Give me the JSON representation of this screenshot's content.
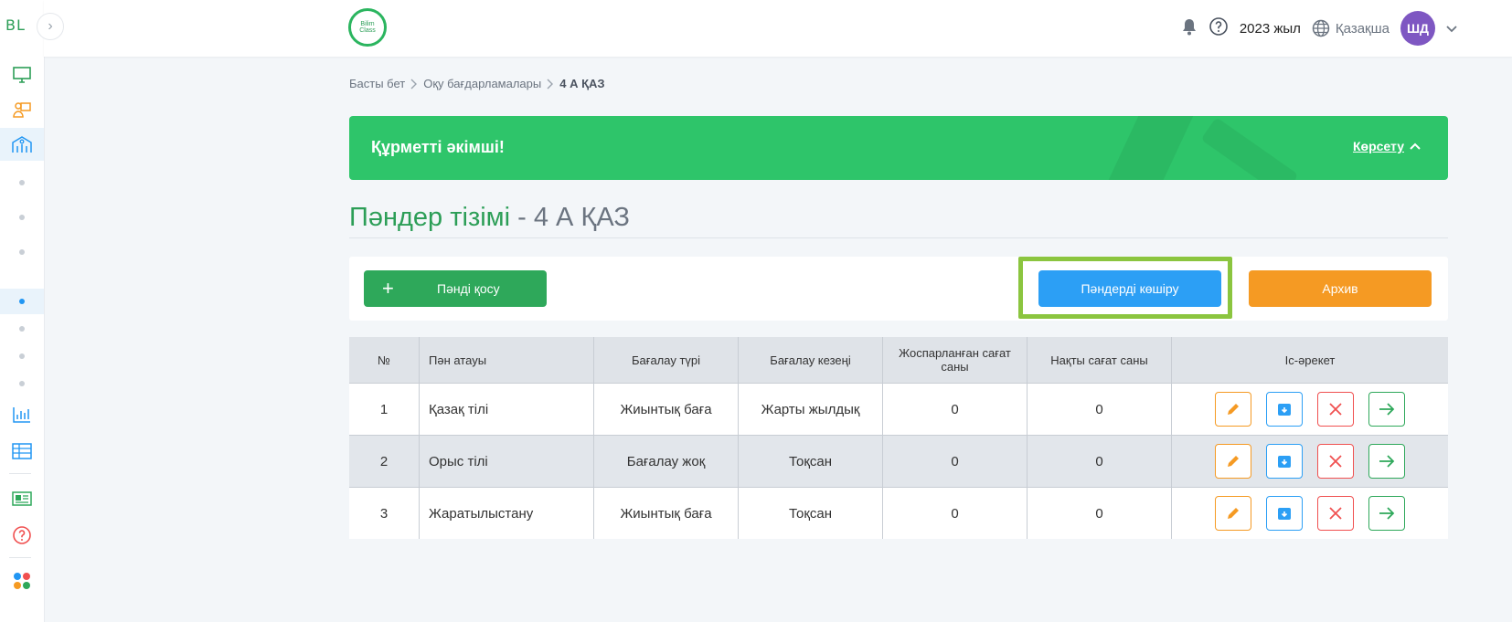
{
  "sidebar": {
    "logo": "BL",
    "toggle_glyph": "›"
  },
  "header": {
    "brand_line1": "Bilim",
    "brand_line2": "Class",
    "year": "2023 жыл",
    "language": "Қазақша",
    "avatar_initials": "ШД"
  },
  "breadcrumb": {
    "items": [
      "Басты бет",
      "Оқу бағдарламалары"
    ],
    "current": "4 А ҚАЗ"
  },
  "banner": {
    "title": "Құрметті әкімші!",
    "link": "Көрсету",
    "color": "#2ec56a"
  },
  "page": {
    "title": "Пәндер тізімі",
    "separator": " - ",
    "class_name": "4 А ҚАЗ"
  },
  "actions": {
    "add_label": "Пәнді қосу",
    "add_glyph": "+",
    "copy_label": "Пәндерді көшіру",
    "archive_label": "Архив"
  },
  "table": {
    "headers": [
      "№",
      "Пән атауы",
      "Бағалау түрі",
      "Бағалау кезеңі",
      "Жоспарланған сағат саны",
      "Нақты сағат саны",
      "Іс-әрекет"
    ],
    "rows": [
      {
        "num": "1",
        "name": "Қазақ тілі",
        "type": "Жиынтық баға",
        "period": "Жарты жылдық",
        "planned": "0",
        "actual": "0"
      },
      {
        "num": "2",
        "name": "Орыс тілі",
        "type": "Бағалау жоқ",
        "period": "Тоқсан",
        "planned": "0",
        "actual": "0"
      },
      {
        "num": "3",
        "name": "Жаратылыстану",
        "type": "Жиынтық баға",
        "period": "Тоқсан",
        "planned": "0",
        "actual": "0"
      }
    ]
  },
  "colors": {
    "brand_green": "#2c9e57",
    "add_button": "#2ea85a",
    "copy_button": "#2c9ff5",
    "archive_button": "#f59a23",
    "highlight_outline": "#8bc53f",
    "avatar": "#7e57c2"
  }
}
